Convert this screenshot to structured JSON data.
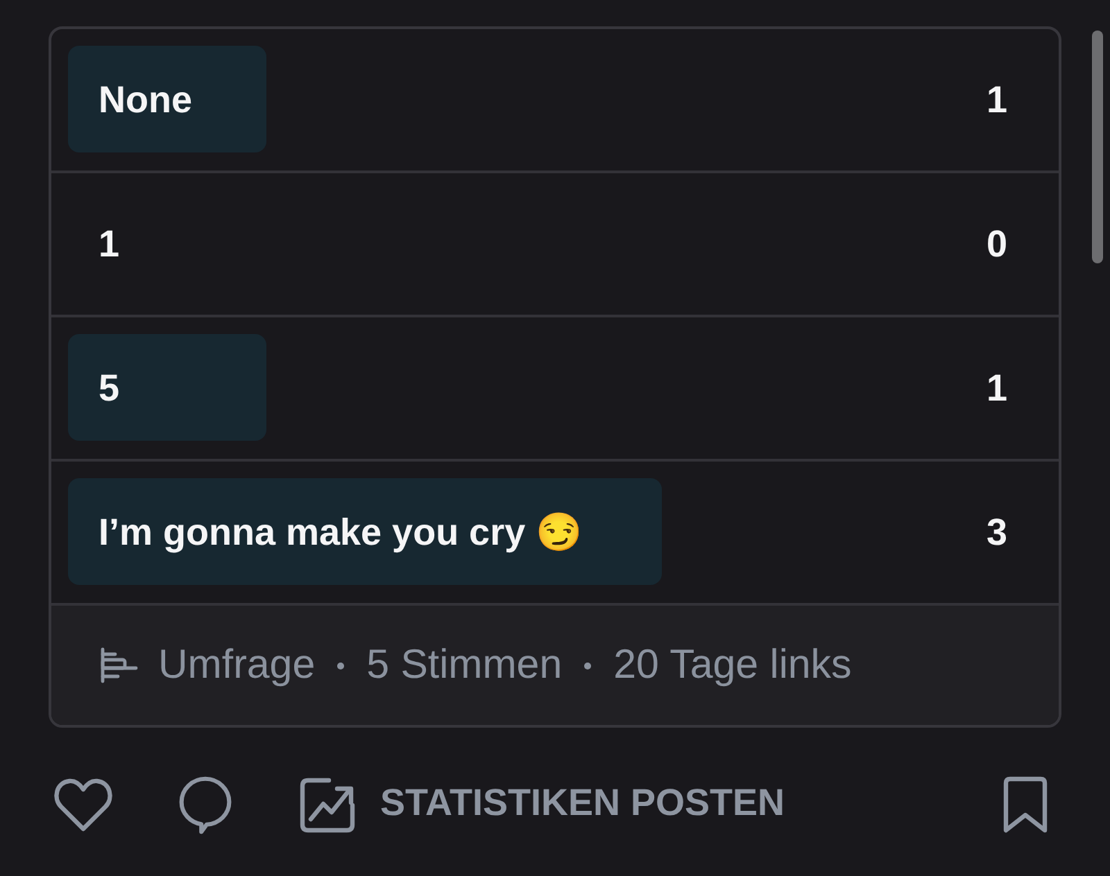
{
  "poll": {
    "options": [
      {
        "label": "None",
        "votes": "1",
        "level": 0.2
      },
      {
        "label": "1",
        "votes": "0",
        "level": 0
      },
      {
        "label": "5",
        "votes": "1",
        "level": 0.2
      },
      {
        "label": "I’m gonna make you cry 😏",
        "votes": "3",
        "level": 0.6
      }
    ],
    "footer": {
      "type_label": "Umfrage",
      "votes": "5 Stimmen",
      "time_left": "20 Tage links"
    }
  },
  "actions": {
    "stats_label": "STATISTIKEN POSTEN"
  }
}
